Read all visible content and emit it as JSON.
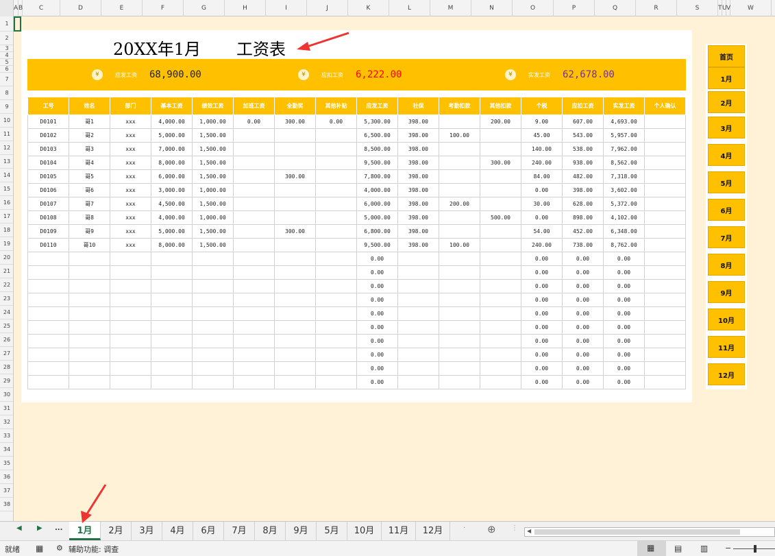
{
  "columns": [
    "A",
    "B",
    "C",
    "D",
    "E",
    "F",
    "G",
    "H",
    "I",
    "J",
    "K",
    "L",
    "M",
    "N",
    "O",
    "P",
    "Q",
    "R",
    "S",
    "T",
    "U",
    "V",
    "W"
  ],
  "rows": [
    "1",
    "2",
    "3",
    "4",
    "5",
    "6",
    "7",
    "8",
    "9",
    "10",
    "11",
    "12",
    "13",
    "14",
    "15",
    "16",
    "17",
    "18",
    "19",
    "20",
    "21",
    "22",
    "23",
    "24",
    "25",
    "26",
    "27",
    "28",
    "29",
    "30",
    "31",
    "32",
    "33",
    "34",
    "35",
    "36",
    "37",
    "38"
  ],
  "title": {
    "month": "20XX年1月",
    "name": "工资表"
  },
  "summary": [
    {
      "label": "应发工资",
      "value": "68,900.00",
      "color": "#222222"
    },
    {
      "label": "应扣工资",
      "value": "6,222.00",
      "color": "#ff0000"
    },
    {
      "label": "实发工资",
      "value": "62,678.00",
      "color": "#7030a0"
    }
  ],
  "table": {
    "headers": [
      "工号",
      "姓名",
      "部门",
      "基本工资",
      "绩效工资",
      "加班工资",
      "全勤奖",
      "其他补贴",
      "应发工资",
      "社保",
      "考勤扣款",
      "其他扣款",
      "个税",
      "应扣工资",
      "实发工资",
      "个人确认"
    ],
    "rows": [
      [
        "D0101",
        "哥1",
        "xxx",
        "4,000.00",
        "1,000.00",
        "0.00",
        "300.00",
        "0.00",
        "5,300.00",
        "398.00",
        "",
        "200.00",
        "9.00",
        "607.00",
        "4,693.00",
        ""
      ],
      [
        "D0102",
        "哥2",
        "xxx",
        "5,000.00",
        "1,500.00",
        "",
        "",
        "",
        "6,500.00",
        "398.00",
        "100.00",
        "",
        "45.00",
        "543.00",
        "5,957.00",
        ""
      ],
      [
        "D0103",
        "哥3",
        "xxx",
        "7,000.00",
        "1,500.00",
        "",
        "",
        "",
        "8,500.00",
        "398.00",
        "",
        "",
        "140.00",
        "538.00",
        "7,962.00",
        ""
      ],
      [
        "D0104",
        "哥4",
        "xxx",
        "8,000.00",
        "1,500.00",
        "",
        "",
        "",
        "9,500.00",
        "398.00",
        "",
        "300.00",
        "240.00",
        "938.00",
        "8,562.00",
        ""
      ],
      [
        "D0105",
        "哥5",
        "xxx",
        "6,000.00",
        "1,500.00",
        "",
        "300.00",
        "",
        "7,800.00",
        "398.00",
        "",
        "",
        "84.00",
        "482.00",
        "7,318.00",
        ""
      ],
      [
        "D0106",
        "哥6",
        "xxx",
        "3,000.00",
        "1,000.00",
        "",
        "",
        "",
        "4,000.00",
        "398.00",
        "",
        "",
        "0.00",
        "398.00",
        "3,602.00",
        ""
      ],
      [
        "D0107",
        "哥7",
        "xxx",
        "4,500.00",
        "1,500.00",
        "",
        "",
        "",
        "6,000.00",
        "398.00",
        "200.00",
        "",
        "30.00",
        "628.00",
        "5,372.00",
        ""
      ],
      [
        "D0108",
        "哥8",
        "xxx",
        "4,000.00",
        "1,000.00",
        "",
        "",
        "",
        "5,000.00",
        "398.00",
        "",
        "500.00",
        "0.00",
        "898.00",
        "4,102.00",
        ""
      ],
      [
        "D0109",
        "哥9",
        "xxx",
        "5,000.00",
        "1,500.00",
        "",
        "300.00",
        "",
        "6,800.00",
        "398.00",
        "",
        "",
        "54.00",
        "452.00",
        "6,348.00",
        ""
      ],
      [
        "D0110",
        "哥10",
        "xxx",
        "8,000.00",
        "1,500.00",
        "",
        "",
        "",
        "9,500.00",
        "398.00",
        "100.00",
        "",
        "240.00",
        "738.00",
        "8,762.00",
        ""
      ],
      [
        "",
        "",
        "",
        "",
        "",
        "",
        "",
        "",
        "0.00",
        "",
        "",
        "",
        "0.00",
        "0.00",
        "0.00",
        ""
      ],
      [
        "",
        "",
        "",
        "",
        "",
        "",
        "",
        "",
        "0.00",
        "",
        "",
        "",
        "0.00",
        "0.00",
        "0.00",
        ""
      ],
      [
        "",
        "",
        "",
        "",
        "",
        "",
        "",
        "",
        "0.00",
        "",
        "",
        "",
        "0.00",
        "0.00",
        "0.00",
        ""
      ],
      [
        "",
        "",
        "",
        "",
        "",
        "",
        "",
        "",
        "0.00",
        "",
        "",
        "",
        "0.00",
        "0.00",
        "0.00",
        ""
      ],
      [
        "",
        "",
        "",
        "",
        "",
        "",
        "",
        "",
        "0.00",
        "",
        "",
        "",
        "0.00",
        "0.00",
        "0.00",
        ""
      ],
      [
        "",
        "",
        "",
        "",
        "",
        "",
        "",
        "",
        "0.00",
        "",
        "",
        "",
        "0.00",
        "0.00",
        "0.00",
        ""
      ],
      [
        "",
        "",
        "",
        "",
        "",
        "",
        "",
        "",
        "0.00",
        "",
        "",
        "",
        "0.00",
        "0.00",
        "0.00",
        ""
      ],
      [
        "",
        "",
        "",
        "",
        "",
        "",
        "",
        "",
        "0.00",
        "",
        "",
        "",
        "0.00",
        "0.00",
        "0.00",
        ""
      ],
      [
        "",
        "",
        "",
        "",
        "",
        "",
        "",
        "",
        "0.00",
        "",
        "",
        "",
        "0.00",
        "0.00",
        "0.00",
        ""
      ],
      [
        "",
        "",
        "",
        "",
        "",
        "",
        "",
        "",
        "0.00",
        "",
        "",
        "",
        "0.00",
        "0.00",
        "0.00",
        ""
      ]
    ]
  },
  "nav_buttons": [
    "首页",
    "1月",
    "2月",
    "3月",
    "4月",
    "5月",
    "6月",
    "7月",
    "8月",
    "9月",
    "10月",
    "11月",
    "12月"
  ],
  "tabs": {
    "ellipsis": "...",
    "items": [
      "1月",
      "2月",
      "3月",
      "4月",
      "6月",
      "7月",
      "8月",
      "9月",
      "5月",
      "10月",
      "11月",
      "12月"
    ],
    "active": 0
  },
  "status": {
    "ready": "就绪",
    "accessibility": "辅助功能: 调查"
  },
  "colors": {
    "accent": "#ffc000",
    "excel_green": "#217346",
    "background": "#fff2d6",
    "annotation_arrow": "#ee3333"
  }
}
